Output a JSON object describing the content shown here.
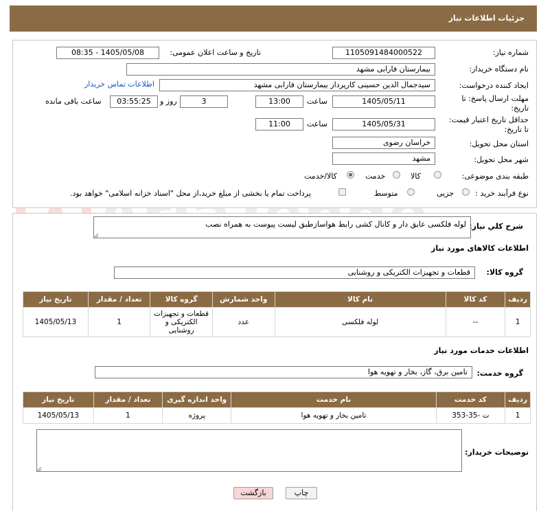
{
  "header": {
    "title": "جزئیات اطلاعات نیاز"
  },
  "form": {
    "need_number_label": "شماره نیاز:",
    "need_number": "1105091484000522",
    "announce_label": "تاریخ و ساعت اعلان عمومی:",
    "announce_value": "1405/05/08 - 08:35",
    "buyer_org_label": "نام دستگاه خریدار:",
    "buyer_org": "بیمارستان فارابی مشهد",
    "requester_label": "ایجاد کننده درخواست:",
    "requester": "سیدجمال الدین حسینی کارپرداز بیمارستان فارابی مشهد",
    "contact_link": "اطلاعات تماس خریدار",
    "deadline_label_1": "مهلت ارسال پاسخ: تا",
    "deadline_label_2": "تاریخ:",
    "deadline_date": "1405/05/11",
    "time_label": "ساعت",
    "deadline_time": "13:00",
    "days_value": "3",
    "days_label": "روز و",
    "remaining_time": "03:55:25",
    "remaining_label": "ساعت باقی مانده",
    "validity_label_1": "حداقل تاریخ اعتبار قیمت:",
    "validity_label_2": "تا تاریخ:",
    "validity_date": "1405/05/31",
    "validity_time": "11:00",
    "province_label": "استان محل تحویل:",
    "province": "خراسان رضوی",
    "city_label": "شهر محل تحویل:",
    "city": "مشهد",
    "category_label": "طبقه بندی موضوعی:",
    "category_options": [
      "کالا",
      "خدمت",
      "کالا/خدمت"
    ],
    "category_selected": "کالا/خدمت",
    "process_label": "نوع فرآیند خرید :",
    "process_options": [
      "جزیی",
      "متوسط"
    ],
    "payment_note": "پرداخت تمام یا بخشی از مبلغ خرید،از محل \"اسناد خزانه اسلامی\" خواهد بود."
  },
  "summary": {
    "label": "شرح کلي نياز:",
    "text": "لوله فلکسی عایق دار و کانال کشی رابط هواسازطبق لیست پیوست به همراه نصب"
  },
  "goods": {
    "section_title": "اطلاعات کالاهای مورد نیاز",
    "group_label": "گروه کالا:",
    "group_value": "قطعات و تجهیزات الکتریکی و روشنایی",
    "columns": [
      "ردیف",
      "کد کالا",
      "نام کالا",
      "واحد شمارش",
      "گروه کالا",
      "تعداد / مقدار",
      "تاریخ نیاز"
    ],
    "rows": [
      [
        "1",
        "--",
        "لوله فلکسی",
        "عدد",
        "قطعات و تجهیزات الکتریکی و روشنایی",
        "1",
        "1405/05/13"
      ]
    ]
  },
  "services": {
    "section_title": "اطلاعات خدمات مورد نیاز",
    "group_label": "گروه خدمت:",
    "group_value": "تامین برق، گاز، بخار و تهویه هوا",
    "columns": [
      "ردیف",
      "کد خدمت",
      "نام خدمت",
      "واحد اندازه گیری",
      "تعداد / مقدار",
      "تاریخ نیاز"
    ],
    "rows": [
      [
        "1",
        "ت -35-353",
        "تامین بخار و تهویه هوا",
        "پروژه",
        "1",
        "1405/05/13"
      ]
    ]
  },
  "notes": {
    "label": "توضیحات خریدار:",
    "value": ""
  },
  "buttons": {
    "print": "چاپ",
    "back": "بازگشت"
  },
  "watermark": {
    "text": "AriaTender.neT"
  },
  "colors": {
    "header": "#8b6b43",
    "link": "#1a56c8",
    "back_button": "#f6d6d6",
    "print_button": "#f2f2f2"
  }
}
